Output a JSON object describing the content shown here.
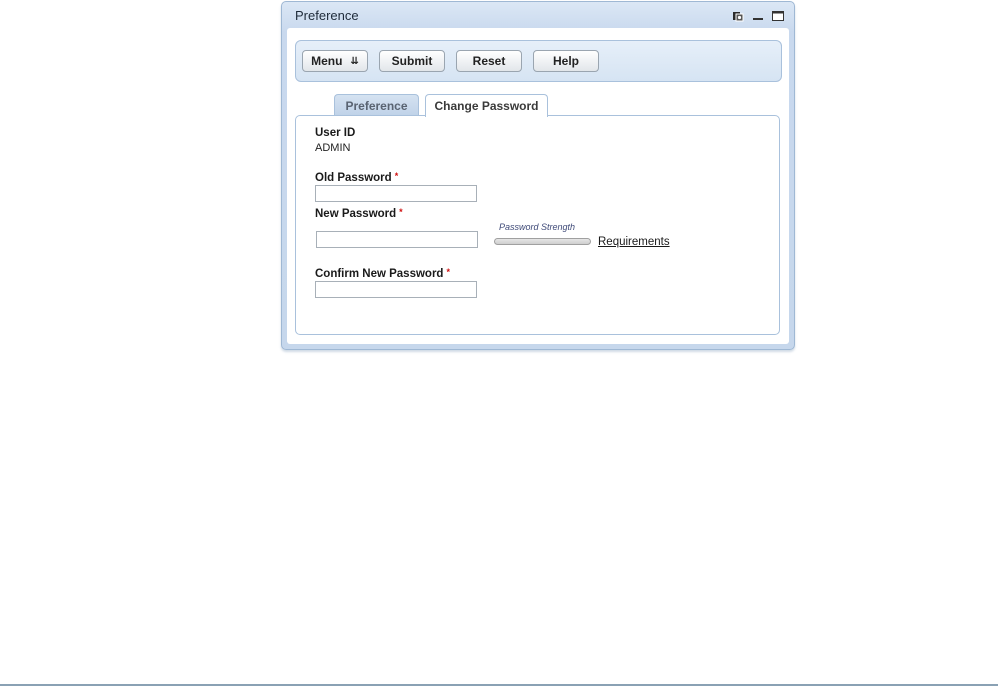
{
  "window": {
    "title": "Preference",
    "icons": [
      "refresh-icon",
      "minimize-icon",
      "maximize-icon"
    ]
  },
  "toolbar": {
    "menu_label": "Menu",
    "menu_chevron": "⇊",
    "submit_label": "Submit",
    "reset_label": "Reset",
    "help_label": "Help"
  },
  "tabs": [
    {
      "label": "Preference",
      "active": false
    },
    {
      "label": "Change Password",
      "active": true
    }
  ],
  "form": {
    "user_id_label": "User ID",
    "user_id_value": "ADMIN",
    "old_password_label": "Old Password",
    "new_password_label": "New Password",
    "confirm_password_label": "Confirm New Password",
    "required_marker": "*",
    "old_password_value": "",
    "new_password_value": "",
    "confirm_password_value": "",
    "strength_label": "Password Strength",
    "requirements_link": "Requirements"
  },
  "colors": {
    "window_bg": "#c9d9ee",
    "border": "#a9c1dc",
    "required": "#d01010"
  }
}
